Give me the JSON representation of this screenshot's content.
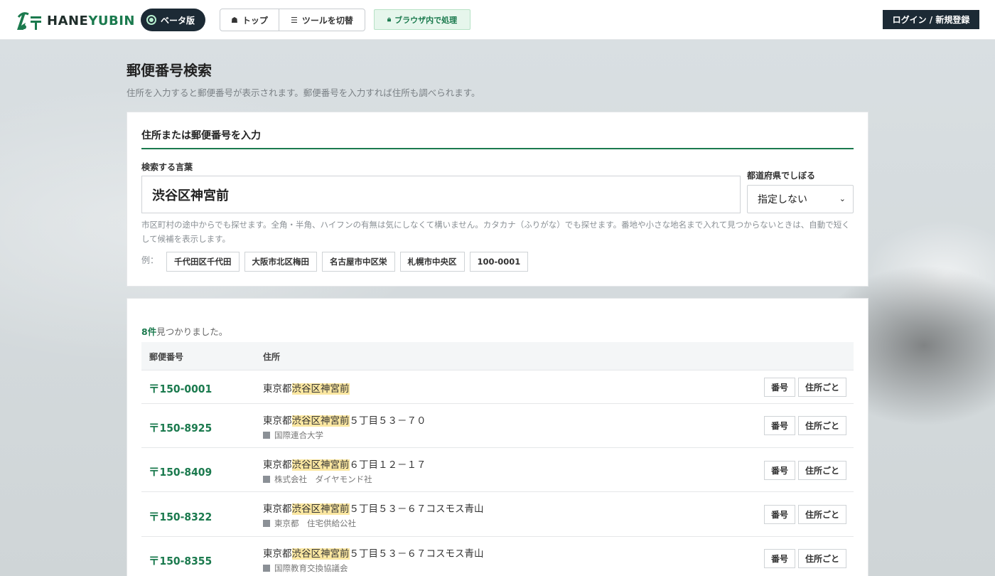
{
  "header": {
    "logo_prefix": "HANE",
    "logo_suffix": "YUBIN",
    "beta_label": "ベータ版",
    "nav_top": "トップ",
    "nav_tools": "ツールを切替",
    "secure_label": "ブラウザ内で処理",
    "login_label": "ログイン / 新規登録"
  },
  "page": {
    "title": "郵便番号検索",
    "subtitle": "住所を入力すると郵便番号が表示されます。郵便番号を入力すれば住所も調べられます。"
  },
  "search": {
    "card_title": "住所または郵便番号を入力",
    "keyword_label": "検索する言葉",
    "keyword_value": "渋谷区神宮前",
    "pref_label": "都道府県でしぼる",
    "pref_value": "指定しない",
    "hint": "市区町村の途中からでも探せます。全角・半角、ハイフンの有無は気にしなくて構いません。カタカナ（ふりがな）でも探せます。番地や小さな地名まで入れて見つからないときは、自動で短くして候補を表示します。",
    "examples_label": "例：",
    "examples": [
      "千代田区千代田",
      "大阪市北区梅田",
      "名古屋市中区栄",
      "札幌市中央区",
      "100-0001"
    ]
  },
  "results": {
    "count": "8件",
    "count_suffix": "見つかりました。",
    "col_zip": "郵便番号",
    "col_addr": "住所",
    "btn_num": "番号",
    "btn_addr": "住所ごと",
    "rows": [
      {
        "zip": "〒150-0001",
        "pre": "東京都",
        "hl": "渋谷区神宮前",
        "post": "",
        "sub": ""
      },
      {
        "zip": "〒150-8925",
        "pre": "東京都",
        "hl": "渋谷区神宮前",
        "post": "５丁目５３－７０",
        "sub": "国際連合大学"
      },
      {
        "zip": "〒150-8409",
        "pre": "東京都",
        "hl": "渋谷区神宮前",
        "post": "６丁目１２－１７",
        "sub": "株式会社　ダイヤモンド社"
      },
      {
        "zip": "〒150-8322",
        "pre": "東京都",
        "hl": "渋谷区神宮前",
        "post": "５丁目５３－６７コスモス青山",
        "sub": "東京都　住宅供給公社"
      },
      {
        "zip": "〒150-8355",
        "pre": "東京都",
        "hl": "渋谷区神宮前",
        "post": "５丁目５３－６７コスモス青山",
        "sub": "国際教育交換協議会"
      }
    ]
  },
  "colors": {
    "accent": "#1b7a4e",
    "dark": "#1c2a35",
    "highlight": "#fbe7a1"
  }
}
